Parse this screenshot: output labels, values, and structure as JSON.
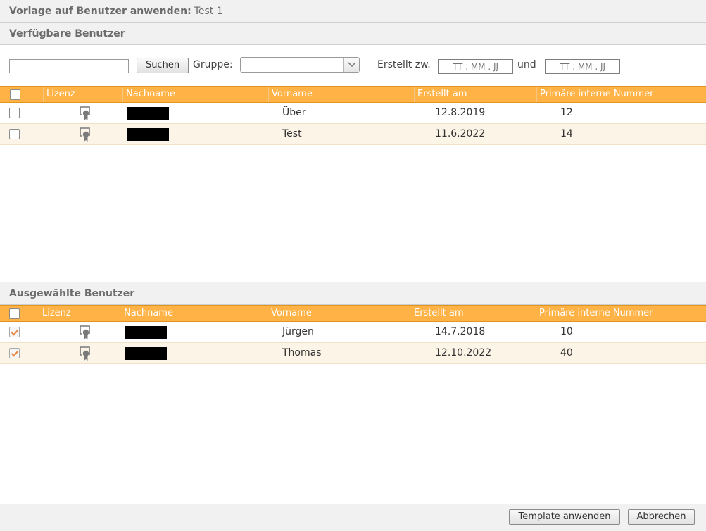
{
  "header": {
    "title_label": "Vorlage auf Benutzer anwenden:",
    "template_name": "Test 1"
  },
  "available": {
    "section_title": "Verfügbare Benutzer",
    "search": {
      "value": "",
      "placeholder": "",
      "button_label": "Suchen"
    },
    "group": {
      "label": "Gruppe:",
      "selected": ""
    },
    "created_between": {
      "label": "Erstellt zw.",
      "from_placeholder": "TT . MM . JJ",
      "and_label": "und",
      "to_placeholder": "TT . MM . JJ"
    },
    "columns": [
      "Lizenz",
      "Nachname",
      "Vorname",
      "Erstellt am",
      "Primäre interne Nummer"
    ],
    "rows": [
      {
        "checked": false,
        "license_icon": "license-certificate-icon",
        "nachname": "",
        "vorname": "Über",
        "erstellt_am": "12.8.2019",
        "nummer": "12"
      },
      {
        "checked": false,
        "license_icon": "license-certificate-icon",
        "nachname": "",
        "vorname": "Test",
        "erstellt_am": "11.6.2022",
        "nummer": "14"
      }
    ]
  },
  "selected": {
    "section_title": "Ausgewählte Benutzer",
    "columns": [
      "Lizenz",
      "Nachname",
      "Vorname",
      "Erstellt am",
      "Primäre interne Nummer"
    ],
    "rows": [
      {
        "checked": true,
        "license_icon": "license-certificate-icon",
        "nachname": "",
        "vorname": "Jürgen",
        "erstellt_am": "14.7.2018",
        "nummer": "10"
      },
      {
        "checked": true,
        "license_icon": "license-certificate-icon",
        "nachname": "",
        "vorname": "Thomas",
        "erstellt_am": "12.10.2022",
        "nummer": "40"
      }
    ]
  },
  "footer": {
    "apply_label": "Template anwenden",
    "cancel_label": "Abbrechen"
  },
  "colors": {
    "header_orange": "#ffb347",
    "accent_check": "#e8833a",
    "row_alt": "#fdf4e8",
    "section_bg": "#f1f1f1"
  }
}
